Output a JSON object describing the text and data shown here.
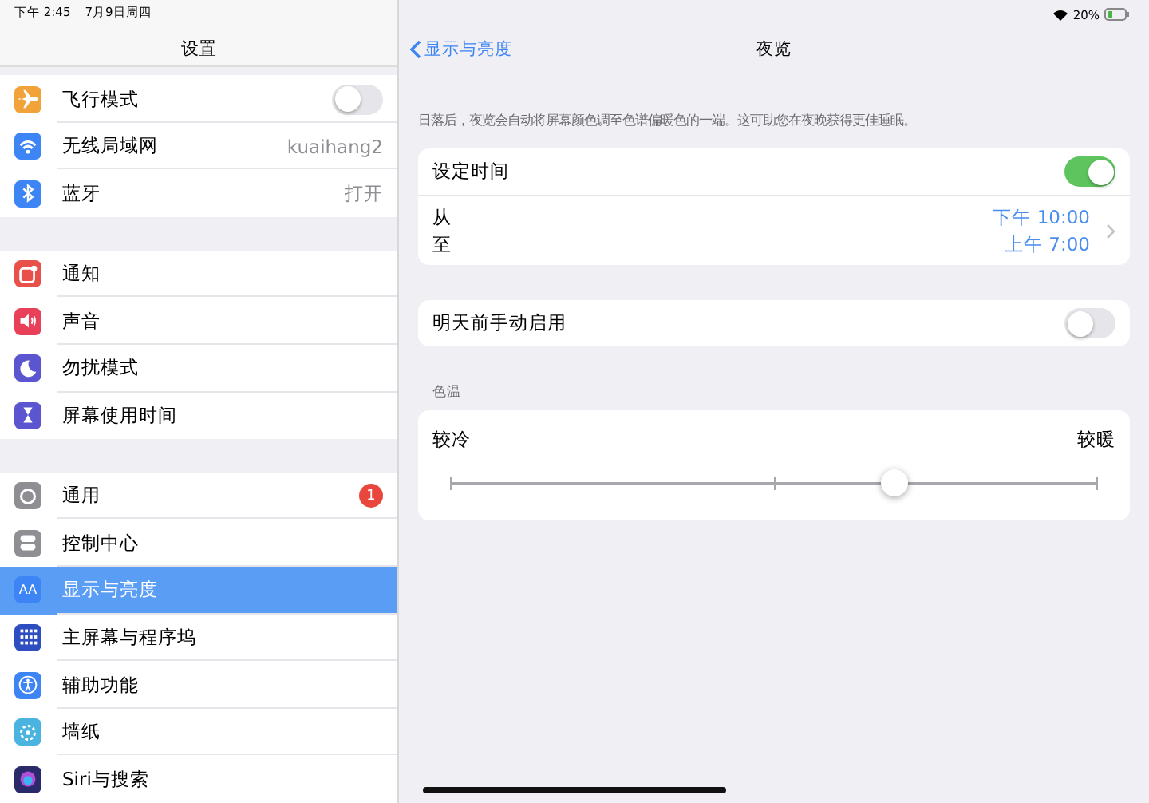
{
  "status_bar": {
    "time": "下午 2:45",
    "date": "7月9日周四",
    "battery": "20%"
  },
  "sidebar": {
    "title": "设置",
    "groups": [
      [
        {
          "label": "飞行模式",
          "kind": "toggle",
          "on": false,
          "selected": false
        },
        {
          "label": "无线局域网",
          "kind": "value",
          "value": "kuaihang2",
          "selected": false
        },
        {
          "label": "蓝牙",
          "kind": "value",
          "value": "打开",
          "selected": false
        }
      ],
      [
        {
          "label": "通知",
          "kind": "plain",
          "selected": false
        },
        {
          "label": "声音",
          "kind": "plain",
          "selected": false
        },
        {
          "label": "勿扰模式",
          "kind": "plain",
          "selected": false
        },
        {
          "label": "屏幕使用时间",
          "kind": "plain",
          "selected": false
        }
      ],
      [
        {
          "label": "通用",
          "kind": "badge",
          "badge": "1",
          "selected": false
        },
        {
          "label": "控制中心",
          "kind": "plain",
          "selected": false
        },
        {
          "label": "显示与亮度",
          "kind": "plain",
          "icon_label": "AA",
          "selected": true
        },
        {
          "label": "主屏幕与程序坞",
          "kind": "plain",
          "selected": false
        },
        {
          "label": "辅助功能",
          "kind": "plain",
          "selected": false
        },
        {
          "label": "墙纸",
          "kind": "plain",
          "selected": false
        },
        {
          "label": "Siri与搜索",
          "kind": "plain",
          "selected": false
        }
      ]
    ]
  },
  "detail": {
    "back": "显示与亮度",
    "title": "夜览",
    "description": "日落后，夜览会自动将屏幕颜色调至色谱偏暖色的一端。这可助您在夜晚获得更佳睡眠。",
    "schedule": {
      "label": "设定时间",
      "on": true,
      "from_label": "从",
      "to_label": "至",
      "from": "下午 10:00",
      "to": "上午 7:00"
    },
    "manual": {
      "label": "明天前手动启用",
      "on": false
    },
    "temperature": {
      "header": "色温",
      "min_label": "较冷",
      "max_label": "较暖",
      "level": 0.685
    }
  }
}
